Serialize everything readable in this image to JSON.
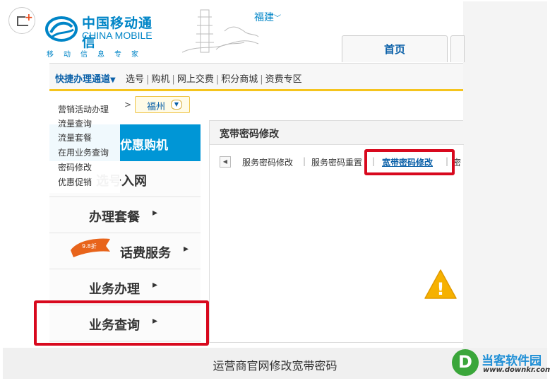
{
  "brand": {
    "name_cn": "中国移动通信",
    "name_en": "CHINA MOBILE",
    "tagline": "移动信息专家",
    "colors": {
      "primary": "#0085c7",
      "accent": "#f5c41d",
      "highlight": "#d8091e"
    }
  },
  "header": {
    "region": "福建",
    "home_tab": "首页"
  },
  "navbar": {
    "quick_label": "快捷办理通道",
    "links": [
      "选号",
      "购机",
      "网上交费",
      "积分商城",
      "资费专区"
    ]
  },
  "breadcrumb": {
    "city": "福州"
  },
  "quick_menu": {
    "items": [
      "营销活动办理",
      "流量查询",
      "流量套餐",
      "在用业务查询",
      "密码修改",
      "优惠促销"
    ]
  },
  "sidebar": {
    "top_label": "优惠购机",
    "items": [
      {
        "label": "选号入网"
      },
      {
        "label": "办理套餐"
      },
      {
        "label": "话费服务",
        "badge": "9.8折"
      },
      {
        "label": "业务办理"
      },
      {
        "label": "业务查询"
      }
    ]
  },
  "panel": {
    "title": "宽带密码修改",
    "subtabs": [
      "服务密码修改",
      "服务密码重置",
      "宽带密码修改",
      "密"
    ],
    "active_tab": "宽带密码修改"
  },
  "warning": {
    "icon": "warning-icon",
    "text": "!"
  },
  "caption": "运营商官网修改宽带密码",
  "watermark": {
    "title": "当客软件园",
    "url": "www.downkr.com"
  }
}
